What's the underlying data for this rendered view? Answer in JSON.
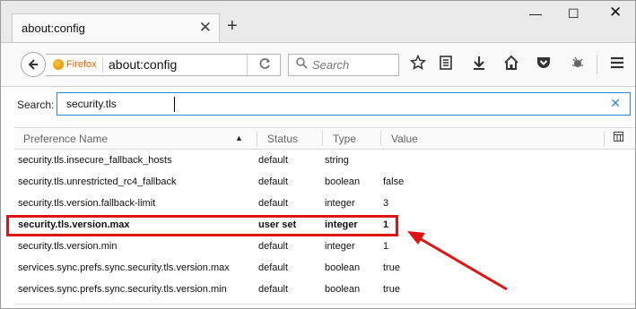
{
  "tab": {
    "title": "about:config",
    "close": "✕",
    "new_tab": "+"
  },
  "window_controls": {
    "minimize": "—",
    "maximize": "☐",
    "close": "✕"
  },
  "navbar": {
    "identity": "Firefox",
    "url": "about:config",
    "reload": "C",
    "search_placeholder": "Search",
    "search_icon": "⚲"
  },
  "toolbar_icons": [
    "star-icon",
    "reading-list-icon",
    "download-icon",
    "home-icon",
    "pocket-icon",
    "extension-icon",
    "menu-icon"
  ],
  "filter": {
    "label": "Search:",
    "value": "security.tls",
    "clear": "✕"
  },
  "columns": {
    "name": "Preference Name",
    "status": "Status",
    "type": "Type",
    "value": "Value"
  },
  "rows": [
    {
      "name": "security.tls.insecure_fallback_hosts",
      "status": "default",
      "type": "string",
      "value": ""
    },
    {
      "name": "security.tls.unrestricted_rc4_fallback",
      "status": "default",
      "type": "boolean",
      "value": "false"
    },
    {
      "name": "security.tls.version.fallback-limit",
      "status": "default",
      "type": "integer",
      "value": "3"
    },
    {
      "name": "security.tls.version.max",
      "status": "user set",
      "type": "integer",
      "value": "1"
    },
    {
      "name": "security.tls.version.min",
      "status": "default",
      "type": "integer",
      "value": "1"
    },
    {
      "name": "services.sync.prefs.sync.security.tls.version.max",
      "status": "default",
      "type": "boolean",
      "value": "true"
    },
    {
      "name": "services.sync.prefs.sync.security.tls.version.min",
      "status": "default",
      "type": "boolean",
      "value": "true"
    }
  ],
  "colors": {
    "annotation": "#e01313",
    "focus": "#2f86d6"
  }
}
